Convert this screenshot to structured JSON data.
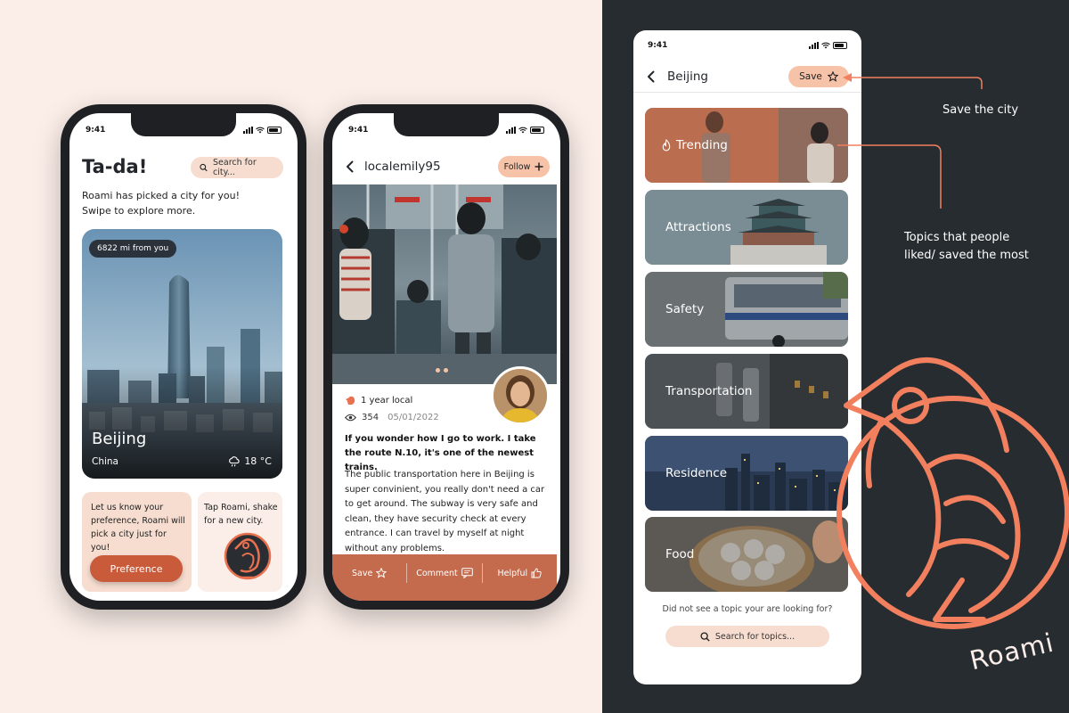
{
  "colors": {
    "accent": "#c95a3a",
    "peach": "#f6ddd0",
    "dark": "#272c31",
    "cream": "#fbeee8",
    "bird": "#f2805f"
  },
  "status_time": "9:41",
  "phone1": {
    "title": "Ta-da!",
    "search_placeholder": "Search for city...",
    "subtitle_line1": "Roami has picked a city for you!",
    "subtitle_line2": "Swipe to explore more.",
    "distance": "6822 mi from you",
    "city": "Beijing",
    "country": "China",
    "temperature": "18 °C",
    "weather_icon": "cloud-rain-icon",
    "preference_text": "Let us know your preference, Roami will pick a city just for you!",
    "preference_button": "Preference",
    "tap_text": "Tap Roami, shake for a new city."
  },
  "phone2": {
    "username": "localemily95",
    "follow_label": "Follow",
    "local_tag": "1 year local",
    "views": "354",
    "date": "05/01/2022",
    "post_title": "If you wonder how I go to work. I take the route N.10, it's one of the newest trains.",
    "post_body": "The public transportation here in Beijing is super convinient, you really don't need a car to get around. The subway is very safe and clean, they have security check at every entrance. I can travel by myself at night without any problems.",
    "actions": {
      "save": "Save",
      "comment": "Comment",
      "helpful": "Helpful"
    }
  },
  "phone3": {
    "title": "Beijing",
    "save_label": "Save",
    "topics": [
      {
        "label": "Trending"
      },
      {
        "label": "Attractions"
      },
      {
        "label": "Safety"
      },
      {
        "label": "Transportation"
      },
      {
        "label": "Residence"
      },
      {
        "label": "Food"
      }
    ],
    "not_found_text": "Did not see a topic your are looking for?",
    "search_placeholder": "Search for topics..."
  },
  "annotations": {
    "save_city": "Save the city",
    "topics_line1": "Topics that people",
    "topics_line2": "liked/ saved the most"
  },
  "brand": "Roami"
}
